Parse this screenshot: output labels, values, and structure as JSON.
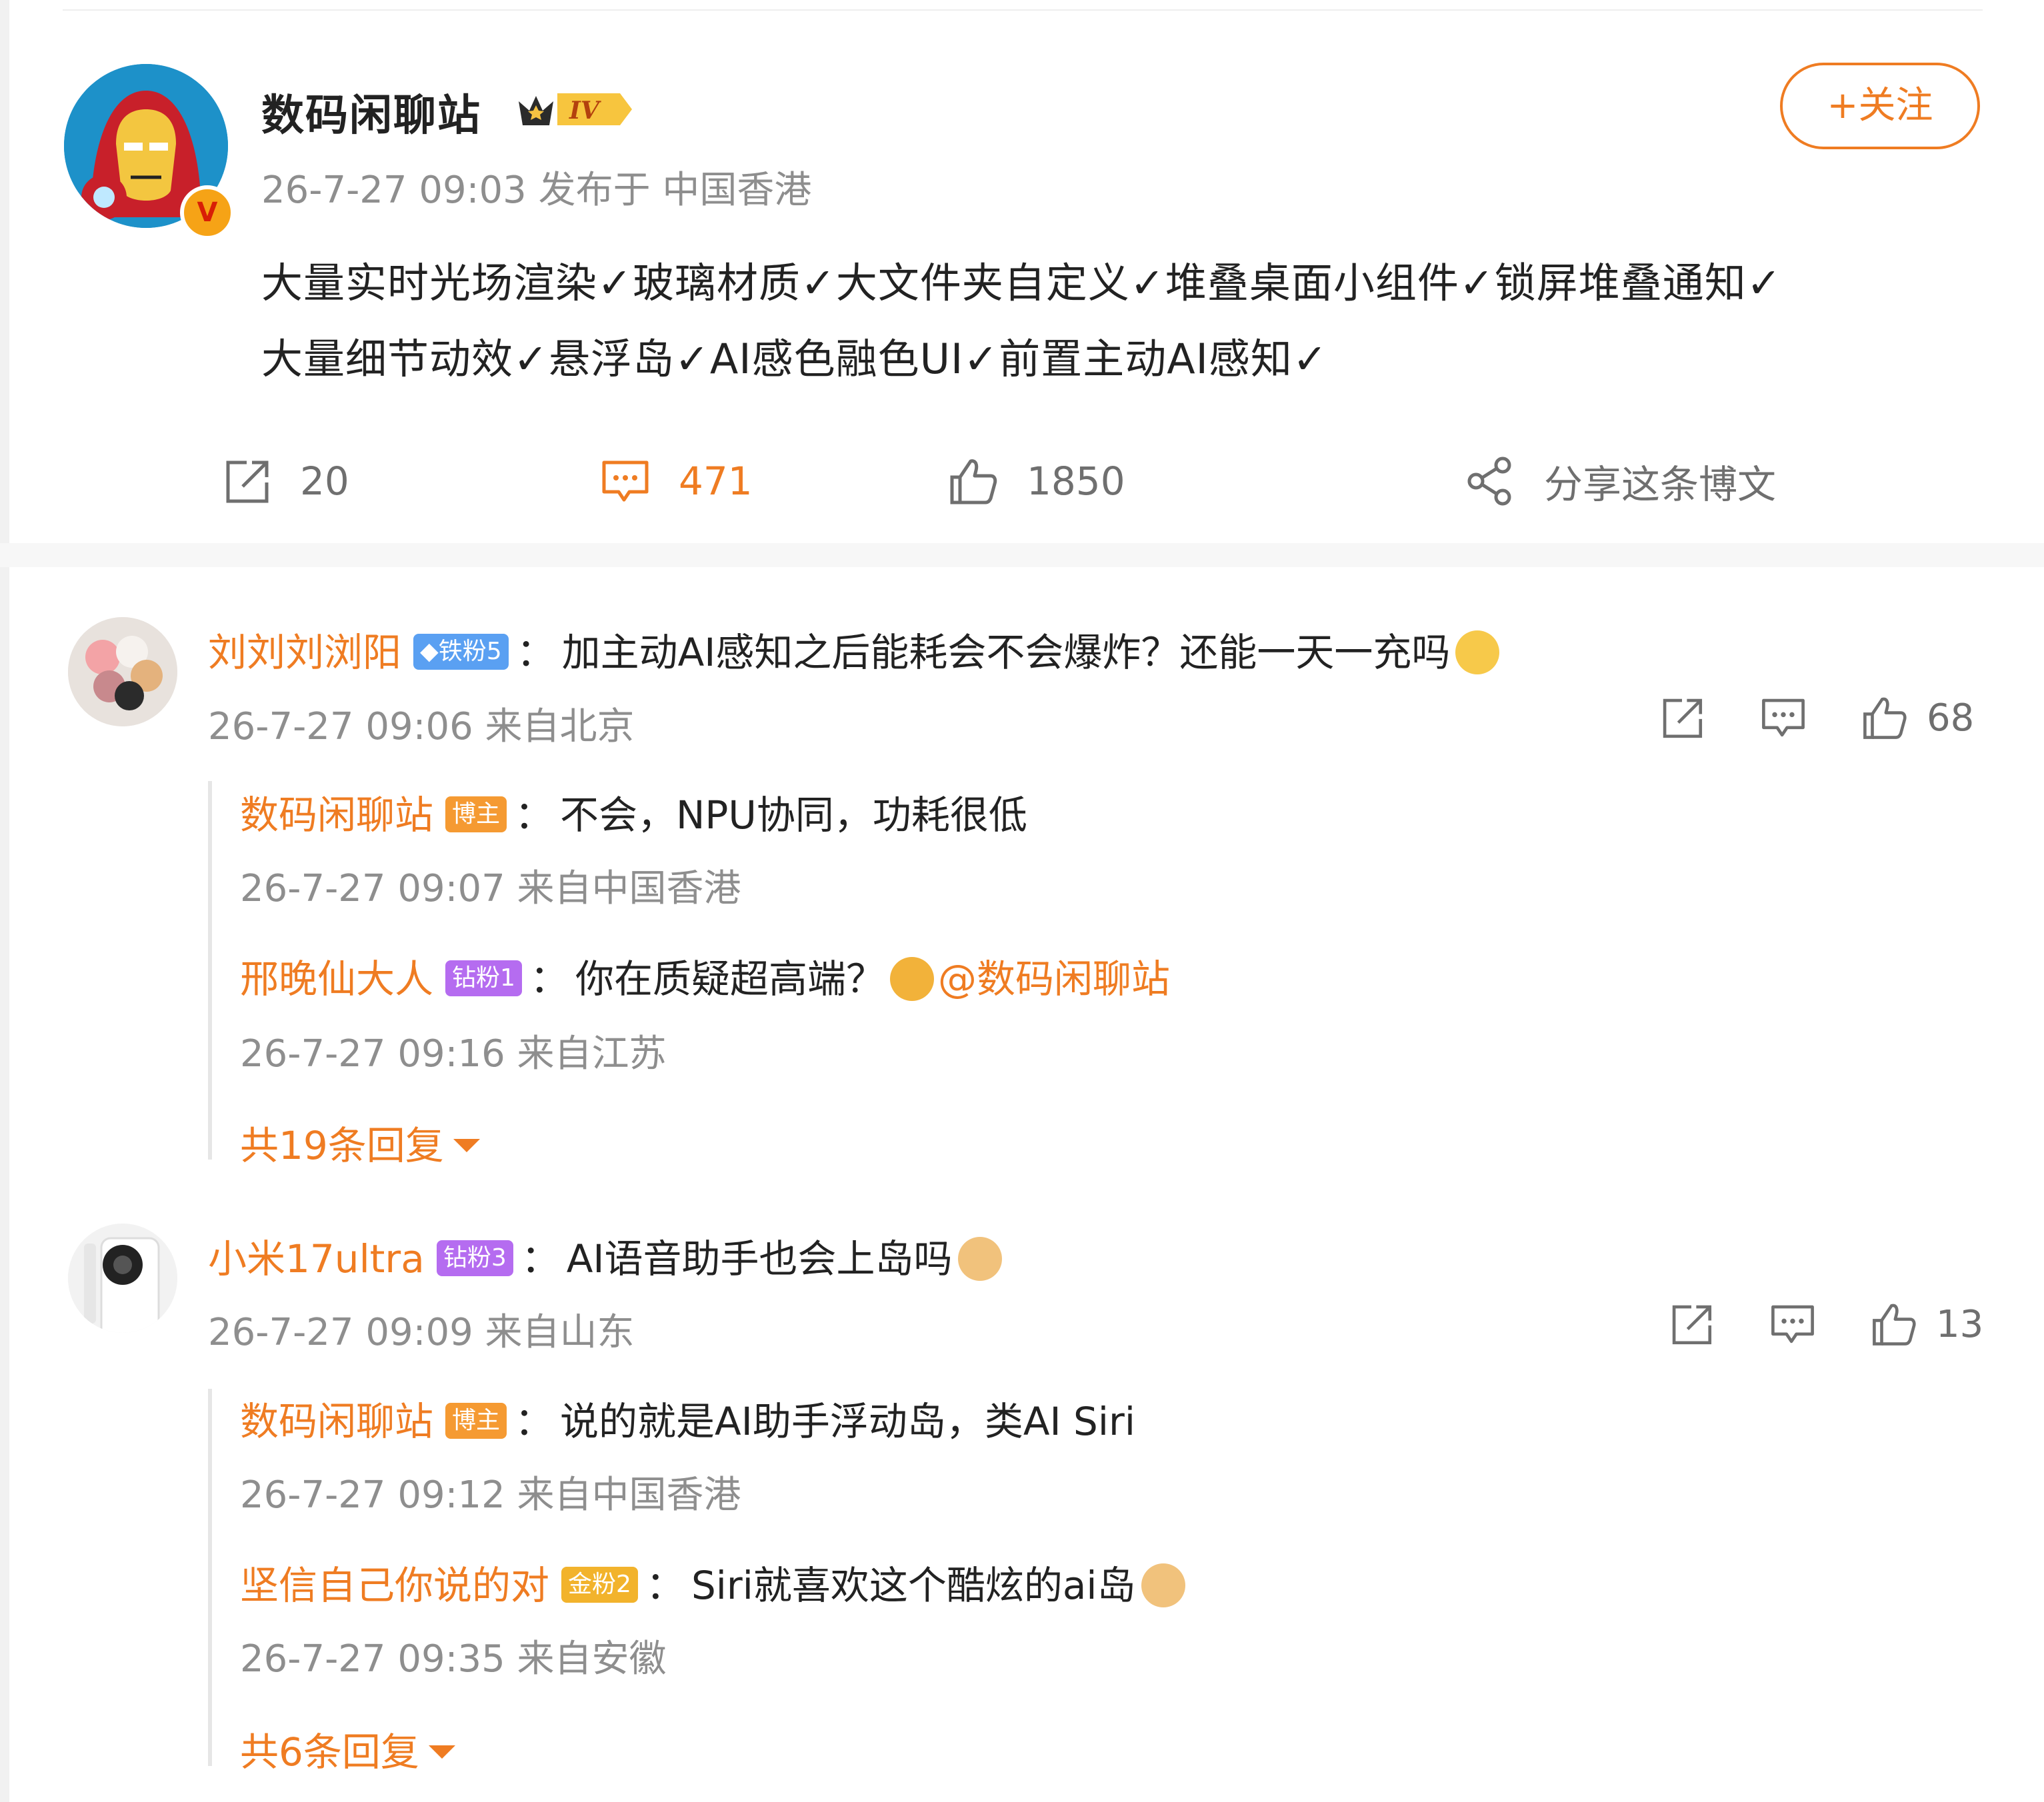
{
  "post": {
    "author": "数码闲聊站",
    "level_badge": "IV",
    "verified": "V",
    "time": "26-7-27 09:03",
    "location": "发布于 中国香港",
    "follow_label": "+关注",
    "text_line1": "大量实时光场渲染✓玻璃材质✓大文件夹自定义✓堆叠桌面小组件✓锁屏堆叠通知✓",
    "text_line2": "大量细节动效✓悬浮岛✓AI感色融色UI✓前置主动AI感知✓"
  },
  "actions": {
    "repost_count": "20",
    "comment_count": "471",
    "like_count": "1850",
    "share_label": "分享这条博文"
  },
  "comments": [
    {
      "user": "刘刘刘浏阳",
      "badge": "◆铁粉5",
      "colon": "：",
      "text": "加主动AI感知之后能耗会不会爆炸？还能一天一充吗",
      "time": "26-7-27 09:06 来自北京",
      "likes": "68",
      "replies": [
        {
          "user": "数码闲聊站",
          "badge": "博主",
          "colon": "：",
          "text": "不会，NPU协同，功耗很低",
          "time": "26-7-27 09:07 来自中国香港"
        },
        {
          "user": "邢晚仙大人",
          "badge": "钻粉1",
          "colon": "：",
          "text": "你在质疑超高端？",
          "mention": "@数码闲聊站",
          "time": "26-7-27 09:16 来自江苏"
        }
      ],
      "more": "共19条回复"
    },
    {
      "user": "小米17ultra",
      "badge": "钻粉3",
      "colon": "：",
      "text": "AI语音助手也会上岛吗",
      "time": "26-7-27 09:09 来自山东",
      "likes": "13",
      "replies": [
        {
          "user": "数码闲聊站",
          "badge": "博主",
          "colon": "：",
          "text": "说的就是AI助手浮动岛，类AI Siri",
          "time": "26-7-27 09:12 来自中国香港"
        },
        {
          "user": "坚信自己你说的对",
          "badge": "金粉2",
          "colon": "：",
          "text": "Siri就喜欢这个酷炫的ai岛",
          "time": "26-7-27 09:35 来自安徽"
        }
      ],
      "more": "共6条回复"
    }
  ],
  "colors": {
    "accent": "#ef7c22",
    "meta": "#8e8e8e",
    "text": "#222222"
  }
}
